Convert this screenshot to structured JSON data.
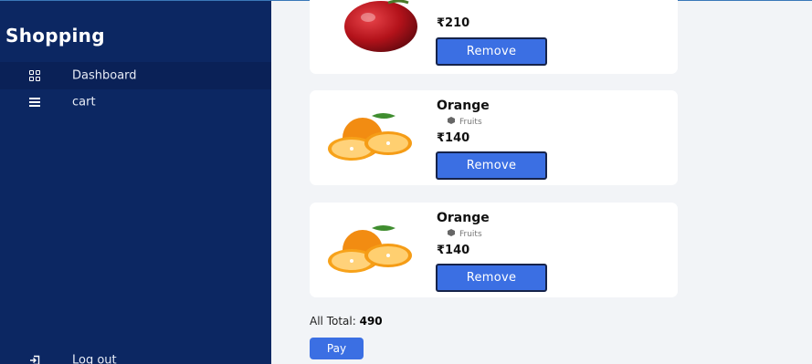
{
  "sidebar": {
    "brand": "Shopping",
    "items": [
      {
        "label": "Dashboard",
        "icon": "dashboard-grid-icon"
      },
      {
        "label": "cart",
        "icon": "list-icon"
      }
    ],
    "logout_label": "Log out"
  },
  "cart": {
    "items": [
      {
        "name": "",
        "category": "",
        "price": "₹210",
        "remove_label": "Remove",
        "image": "apple"
      },
      {
        "name": "Orange",
        "category": "Fruits",
        "price": "₹140",
        "remove_label": "Remove",
        "image": "orange"
      },
      {
        "name": "Orange",
        "category": "Fruits",
        "price": "₹140",
        "remove_label": "Remove",
        "image": "orange"
      }
    ],
    "total_label": "All Total:",
    "total_value": "490",
    "pay_label": "Pay"
  },
  "colors": {
    "sidebar_bg": "#0c2762",
    "accent": "#3b6fe3"
  }
}
